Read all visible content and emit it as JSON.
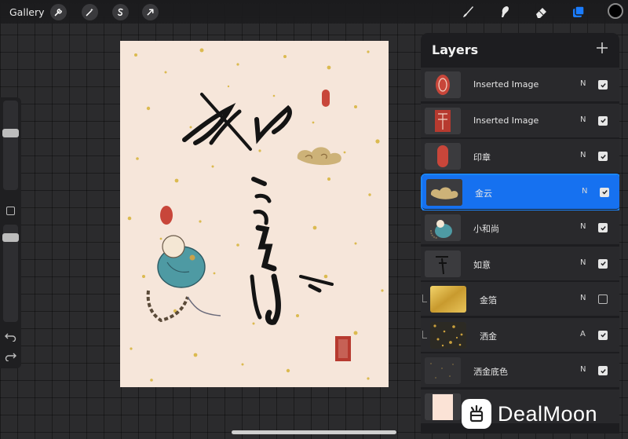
{
  "topbar": {
    "gallery_label": "Gallery",
    "left_tools": [
      "wrench-icon",
      "magic-wand-icon",
      "selection-s-icon",
      "transform-arrow-icon"
    ],
    "right_tools": [
      "brush-icon",
      "smudge-icon",
      "eraser-icon",
      "layers-icon"
    ],
    "active_tool": "layers-icon",
    "current_color": "#000000"
  },
  "sidebar": {
    "size_slider_level": 0.75,
    "opacity_slider_level": 0.9,
    "undo_icon": "undo-icon",
    "redo_icon": "redo-icon"
  },
  "canvas": {
    "background_color": "#f6e6da",
    "artwork": "calligraphy-ruyi"
  },
  "layers": {
    "title": "Layers",
    "add_icon": "plus-icon",
    "items": [
      {
        "name": "Inserted Image",
        "blend": "N",
        "visible": true,
        "selected": false,
        "clipped": false,
        "thumb": "seal-round"
      },
      {
        "name": "Inserted Image",
        "blend": "N",
        "visible": true,
        "selected": false,
        "clipped": false,
        "thumb": "seal-square"
      },
      {
        "name": "印章",
        "blend": "N",
        "visible": true,
        "selected": false,
        "clipped": false,
        "thumb": "seal-oval"
      },
      {
        "name": "金云",
        "blend": "N",
        "visible": true,
        "selected": true,
        "clipped": false,
        "thumb": "gold-cloud"
      },
      {
        "name": "小和尚",
        "blend": "N",
        "visible": true,
        "selected": false,
        "clipped": false,
        "thumb": "monk"
      },
      {
        "name": "如意",
        "blend": "N",
        "visible": true,
        "selected": false,
        "clipped": false,
        "thumb": "calligraphy"
      },
      {
        "name": "金箔",
        "blend": "N",
        "visible": false,
        "selected": false,
        "clipped": true,
        "thumb": "gold-foil"
      },
      {
        "name": "洒金",
        "blend": "A",
        "visible": true,
        "selected": false,
        "clipped": true,
        "thumb": "gold-flecks"
      },
      {
        "name": "洒金底色",
        "blend": "N",
        "visible": true,
        "selected": false,
        "clipped": false,
        "thumb": "dark-flecks"
      },
      {
        "name": "",
        "blend": "",
        "visible": true,
        "selected": false,
        "clipped": false,
        "thumb": "paper"
      }
    ]
  },
  "watermark": {
    "text": "DealMoon"
  }
}
